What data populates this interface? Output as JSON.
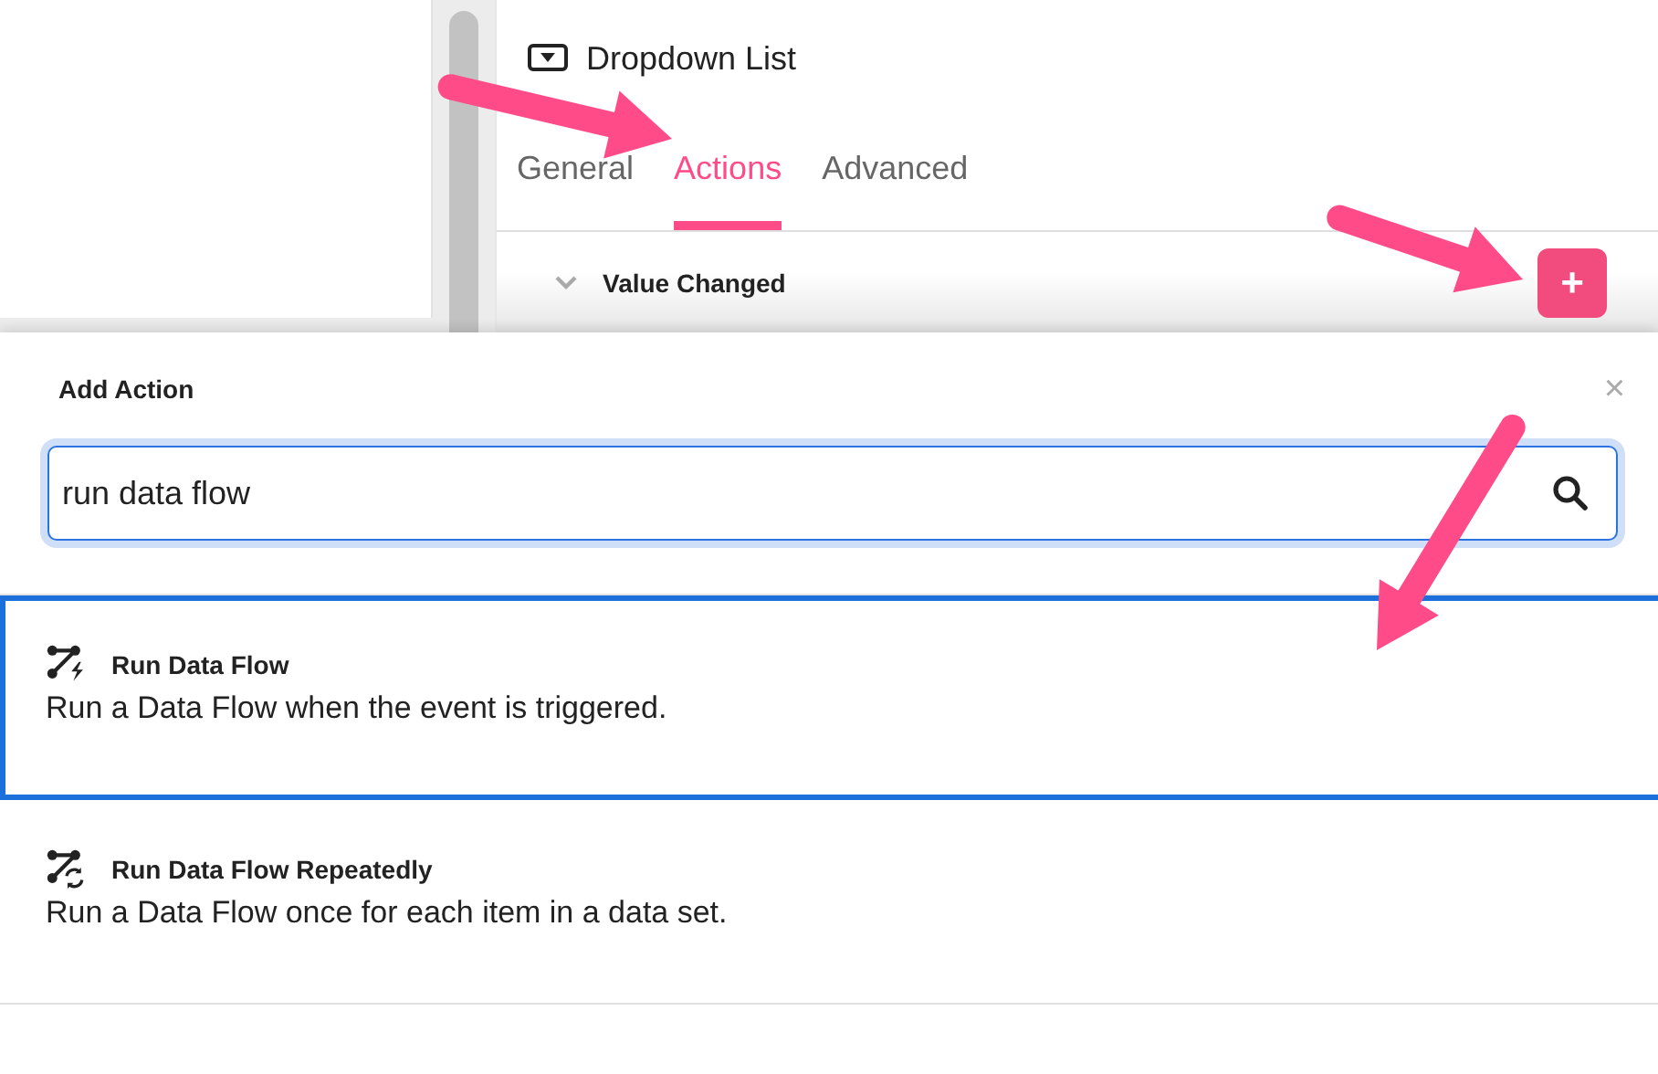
{
  "inspector": {
    "title": "Dropdown List",
    "tabs": [
      {
        "label": "General",
        "selected": false
      },
      {
        "label": "Actions",
        "selected": true
      },
      {
        "label": "Advanced",
        "selected": false
      }
    ],
    "event": {
      "label": "Value Changed",
      "expanded": true,
      "add_button": "+"
    }
  },
  "dialog": {
    "title": "Add Action",
    "close": "×",
    "search": {
      "value": "run data flow"
    },
    "results": [
      {
        "kind": "bolt",
        "title": "Run Data Flow",
        "description": "Run a Data Flow when the event is triggered.",
        "selected": true
      },
      {
        "kind": "repeat",
        "title": "Run Data Flow Repeatedly",
        "description": "Run a Data Flow once for each item in a data set.",
        "selected": false
      }
    ]
  }
}
